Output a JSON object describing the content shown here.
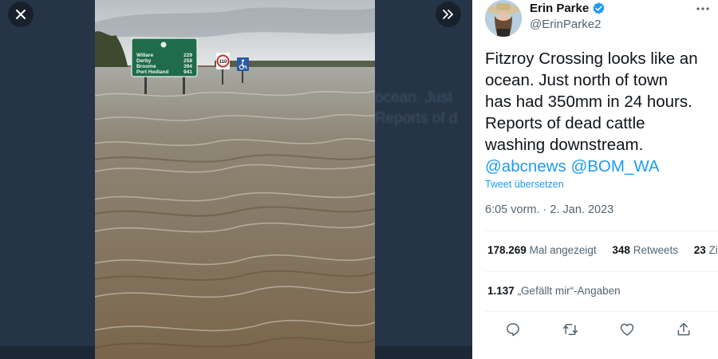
{
  "viewer": {
    "close_icon": "close-icon",
    "next_icon": "chevron-double-right-icon",
    "background_text": [
      "ocean. Just",
      "Reports of d"
    ]
  },
  "sign": {
    "towns": [
      "Willare",
      "Derby",
      "Broome",
      "Port Hedland"
    ],
    "distances": [
      "229",
      "258",
      "394",
      "941"
    ],
    "speed_limit": "110"
  },
  "tweet": {
    "author_name": "Erin Parke",
    "verified_icon": "verified-badge-icon",
    "handle": "@ErinParke2",
    "more_icon": "more-icon",
    "text_lines": [
      "Fitzroy Crossing looks like an",
      "ocean. Just north of town",
      "has had 350mm in 24 hours.",
      "Reports of dead cattle",
      "washing downstream."
    ],
    "mentions": [
      "@abcnews",
      "@BOM_WA"
    ],
    "translate": "Tweet übersetzen",
    "timestamp": "6:05 vorm. · 2. Jan. 2023",
    "views_count": "178.269",
    "views_label": "Mal angezeigt",
    "retweets_count": "348",
    "retweets_label": "Retweets",
    "quotes_count": "23",
    "quotes_label": "Zi",
    "likes_count": "1.137",
    "likes_label": "„Gefällt mir“-Angaben"
  },
  "colors": {
    "accent": "#1d9bf0",
    "text": "#0f1419",
    "secondary": "#536471",
    "stage": "#263447"
  }
}
